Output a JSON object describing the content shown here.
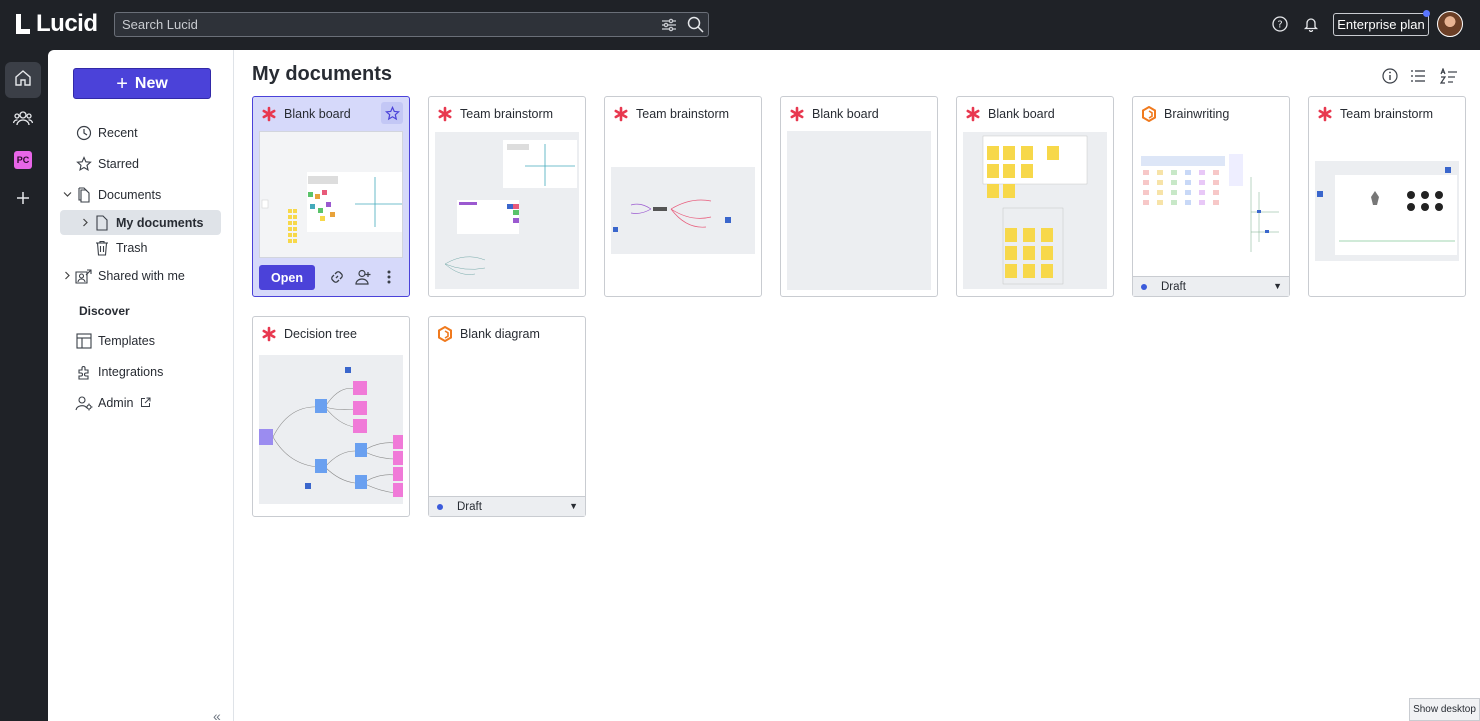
{
  "app": {
    "logo_text": "Lucid"
  },
  "search": {
    "placeholder": "Search Lucid"
  },
  "header": {
    "plan_label": "Enterprise plan"
  },
  "rail": {
    "workspace_badge": "PC"
  },
  "sidebar": {
    "new_label": "New",
    "items": [
      {
        "label": "Recent",
        "icon": "clock-icon"
      },
      {
        "label": "Starred",
        "icon": "star-icon"
      },
      {
        "label": "Documents",
        "icon": "documents-icon"
      },
      {
        "label": "My documents",
        "icon": "document-icon"
      },
      {
        "label": "Trash",
        "icon": "trash-icon"
      },
      {
        "label": "Shared with me",
        "icon": "shared-icon"
      }
    ],
    "discover_label": "Discover",
    "discover_items": [
      {
        "label": "Templates",
        "icon": "templates-icon"
      },
      {
        "label": "Integrations",
        "icon": "puzzle-icon"
      },
      {
        "label": "Admin",
        "icon": "admin-icon"
      }
    ]
  },
  "main": {
    "title": "My documents",
    "documents": [
      {
        "title": "Blank board",
        "type": "lucidspark",
        "selected": true
      },
      {
        "title": "Team brainstorm",
        "type": "lucidspark"
      },
      {
        "title": "Team brainstorm",
        "type": "lucidspark"
      },
      {
        "title": "Blank board",
        "type": "lucidspark"
      },
      {
        "title": "Blank board",
        "type": "lucidspark"
      },
      {
        "title": "Brainwriting",
        "type": "lucidchart",
        "status": "Draft"
      },
      {
        "title": "Team brainstorm",
        "type": "lucidspark"
      },
      {
        "title": "Decision tree",
        "type": "lucidspark"
      },
      {
        "title": "Blank diagram",
        "type": "lucidchart",
        "status": "Draft"
      }
    ],
    "open_label": "Open"
  },
  "footer": {
    "show_desktop": "Show desktop"
  },
  "colors": {
    "accent": "#4b42d9",
    "spark": "#e8384f",
    "chart": "#f07a1e"
  }
}
